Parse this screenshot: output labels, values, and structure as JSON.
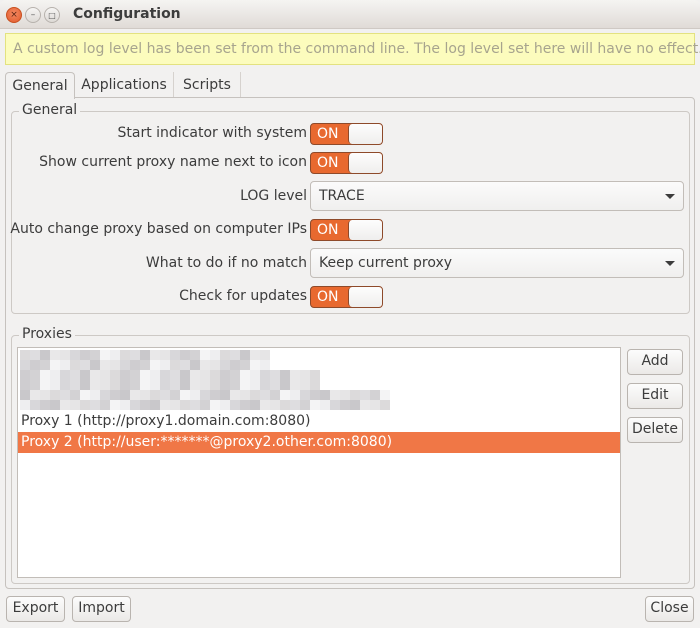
{
  "window": {
    "title": "Configuration",
    "controls": {
      "close": "×",
      "minimize": "–",
      "maximize": "□"
    }
  },
  "infobar": {
    "message": "A custom log level has been set from the command line. The log level set here will have no effect."
  },
  "tabs": [
    {
      "label": "General",
      "active": true
    },
    {
      "label": "Applications",
      "active": false
    },
    {
      "label": "Scripts",
      "active": false
    }
  ],
  "general": {
    "section_title": "General",
    "start_indicator": {
      "label": "Start indicator with system",
      "state": "ON"
    },
    "show_proxy_name": {
      "label": "Show current proxy name next to icon",
      "state": "ON"
    },
    "log_level": {
      "label": "LOG level",
      "value": "TRACE"
    },
    "auto_change": {
      "label": "Auto change proxy based on computer IPs",
      "state": "ON"
    },
    "no_match": {
      "label": "What to do if no match",
      "value": "Keep current proxy"
    },
    "check_updates": {
      "label": "Check for updates",
      "state": "ON"
    }
  },
  "proxies": {
    "section_title": "Proxies",
    "items": [
      {
        "label": "Proxy 1 (http://proxy1.domain.com:8080)",
        "selected": false
      },
      {
        "label": "Proxy 2 (http://user:*******@proxy2.other.com:8080)",
        "selected": true
      }
    ],
    "redacted_rows": 3,
    "buttons": {
      "add": "Add",
      "edit": "Edit",
      "delete": "Delete"
    }
  },
  "footer": {
    "export": "Export",
    "import": "Import",
    "close": "Close"
  },
  "colors": {
    "accent": "#e8692f",
    "selection": "#f07746",
    "infobar_bg": "#fcfcbd"
  }
}
